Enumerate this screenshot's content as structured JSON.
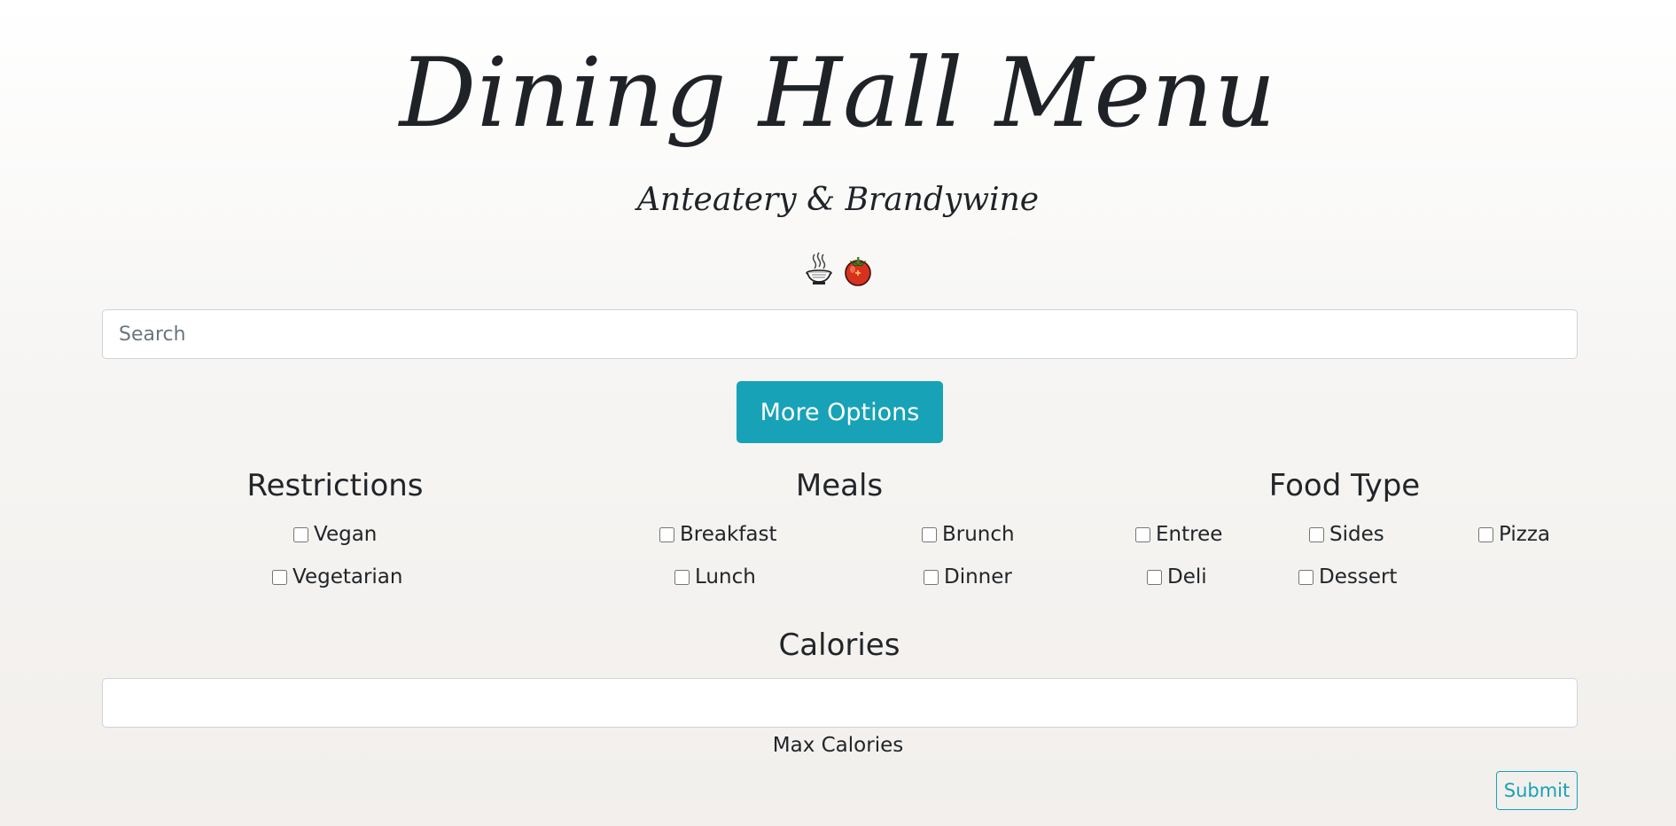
{
  "header": {
    "title": "Dining Hall Menu",
    "subtitle": "Anteatery & Brandywine",
    "icons": [
      "noodle-bowl-icon",
      "tomato-icon"
    ]
  },
  "search": {
    "placeholder": "Search",
    "value": ""
  },
  "more_options_label": "More Options",
  "restrictions": {
    "title": "Restrictions",
    "options": [
      {
        "label": "Vegan",
        "checked": false
      },
      {
        "label": "Vegetarian",
        "checked": false
      }
    ]
  },
  "meals": {
    "title": "Meals",
    "options": [
      {
        "label": "Breakfast",
        "checked": false
      },
      {
        "label": "Brunch",
        "checked": false
      },
      {
        "label": "Lunch",
        "checked": false
      },
      {
        "label": "Dinner",
        "checked": false
      }
    ]
  },
  "food_type": {
    "title": "Food Type",
    "options": [
      {
        "label": "Entree",
        "checked": false
      },
      {
        "label": "Sides",
        "checked": false
      },
      {
        "label": "Pizza",
        "checked": false
      },
      {
        "label": "Deli",
        "checked": false
      },
      {
        "label": "Dessert",
        "checked": false
      }
    ]
  },
  "calories": {
    "title": "Calories",
    "value": "",
    "helper": "Max Calories"
  },
  "submit_label": "Submit",
  "colors": {
    "accent": "#17a2b8",
    "text": "#212529",
    "border": "#ced4da"
  }
}
